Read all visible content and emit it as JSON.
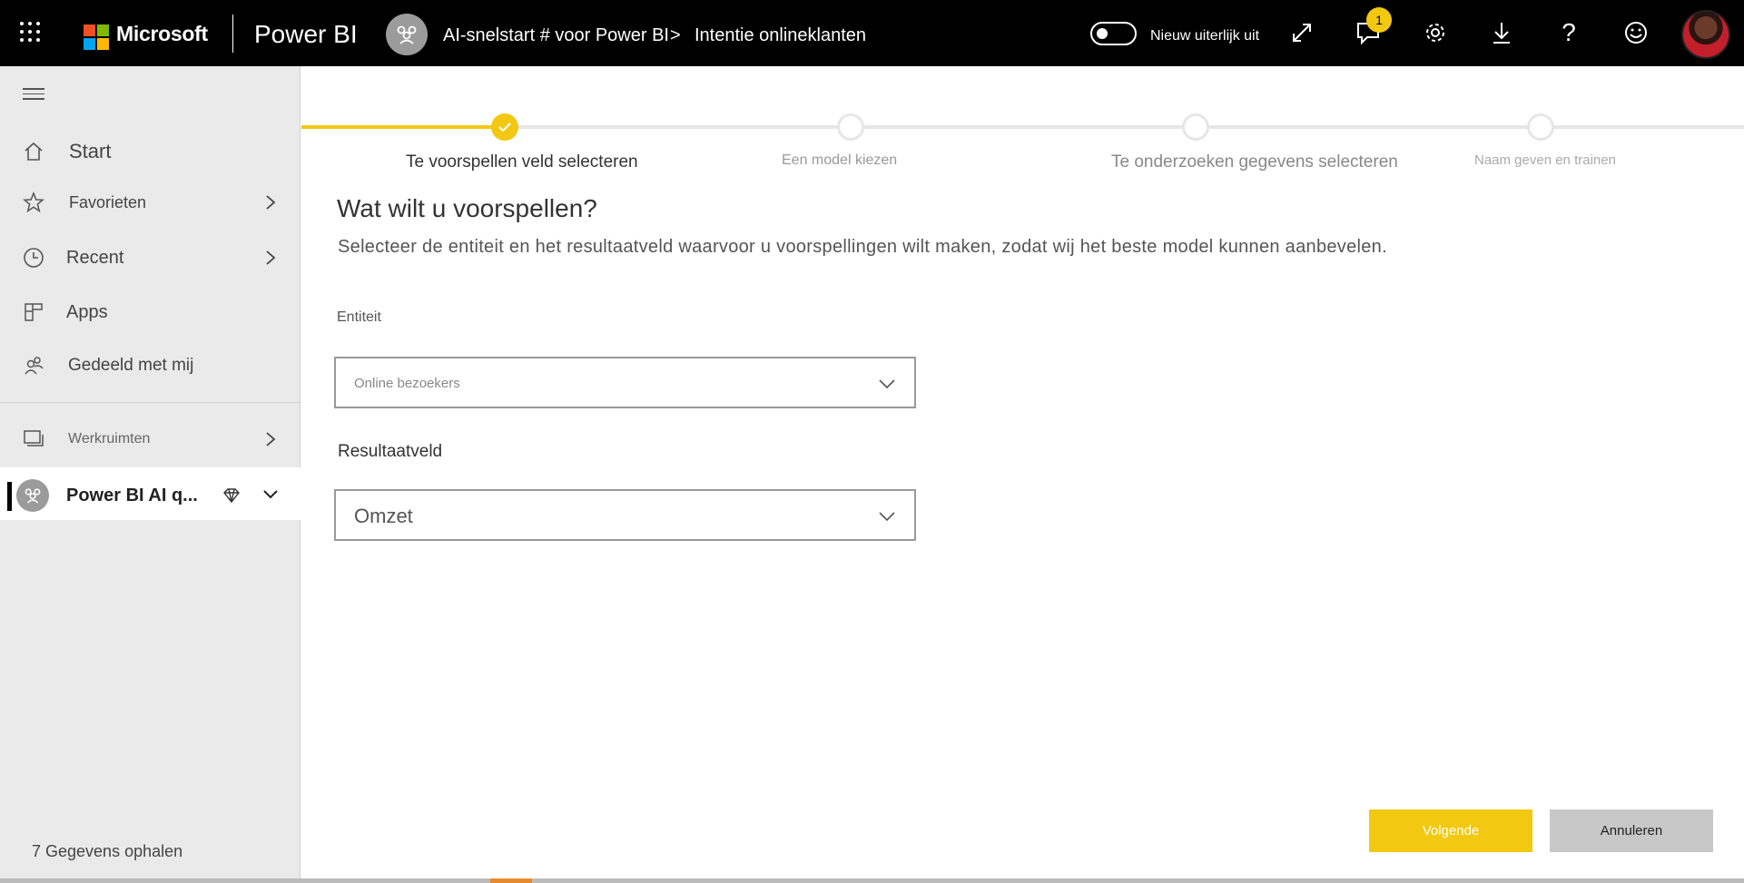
{
  "topbar": {
    "brand": "Microsoft",
    "product": "Power BI",
    "breadcrumb_workspace": "AI-snelstart # voor Power BI",
    "breadcrumb_separator": ">",
    "breadcrumb_page": "Intentie onlineklanten",
    "toggle_label": "Nieuw uiterlijk uit",
    "notification_count": "1",
    "icons": [
      "waffle-icon",
      "expand-icon",
      "notifications-icon",
      "settings-icon",
      "download-icon",
      "help-icon",
      "feedback-icon"
    ]
  },
  "sidebar": {
    "items": [
      {
        "label": "Start",
        "icon": "home-icon"
      },
      {
        "label": "Favorieten",
        "icon": "star-icon"
      },
      {
        "label": "Recent",
        "icon": "clock-icon"
      },
      {
        "label": "Apps",
        "icon": "apps-icon"
      },
      {
        "label": "Gedeeld met mij",
        "icon": "shared-icon"
      },
      {
        "label": "Werkruimten",
        "icon": "workspaces-icon"
      }
    ],
    "current_workspace": "Power BI AI q...",
    "get_data": "7 Gegevens ophalen"
  },
  "stepper": {
    "steps": [
      {
        "label": "Te voorspellen veld selecteren",
        "state": "done"
      },
      {
        "label": "Een model kiezen",
        "state": "pending"
      },
      {
        "label": "Te onderzoeken gegevens selecteren",
        "state": "pending"
      },
      {
        "label": "Naam geven en trainen",
        "state": "pending"
      }
    ]
  },
  "main": {
    "title": "Wat wilt u voorspellen?",
    "subtitle": "Selecteer de entiteit en het resultaatveld waarvoor u voorspellingen wilt maken, zodat wij het beste model kunnen aanbevelen.",
    "entity_label": "Entiteit",
    "entity_value": "Online bezoekers",
    "result_label": "Resultaatveld",
    "result_value": "Omzet"
  },
  "buttons": {
    "next": "Volgende",
    "cancel": "Annuleren"
  },
  "colors": {
    "accent": "#f2c811",
    "topbar": "#000000",
    "sidebar": "#eaeaea"
  }
}
